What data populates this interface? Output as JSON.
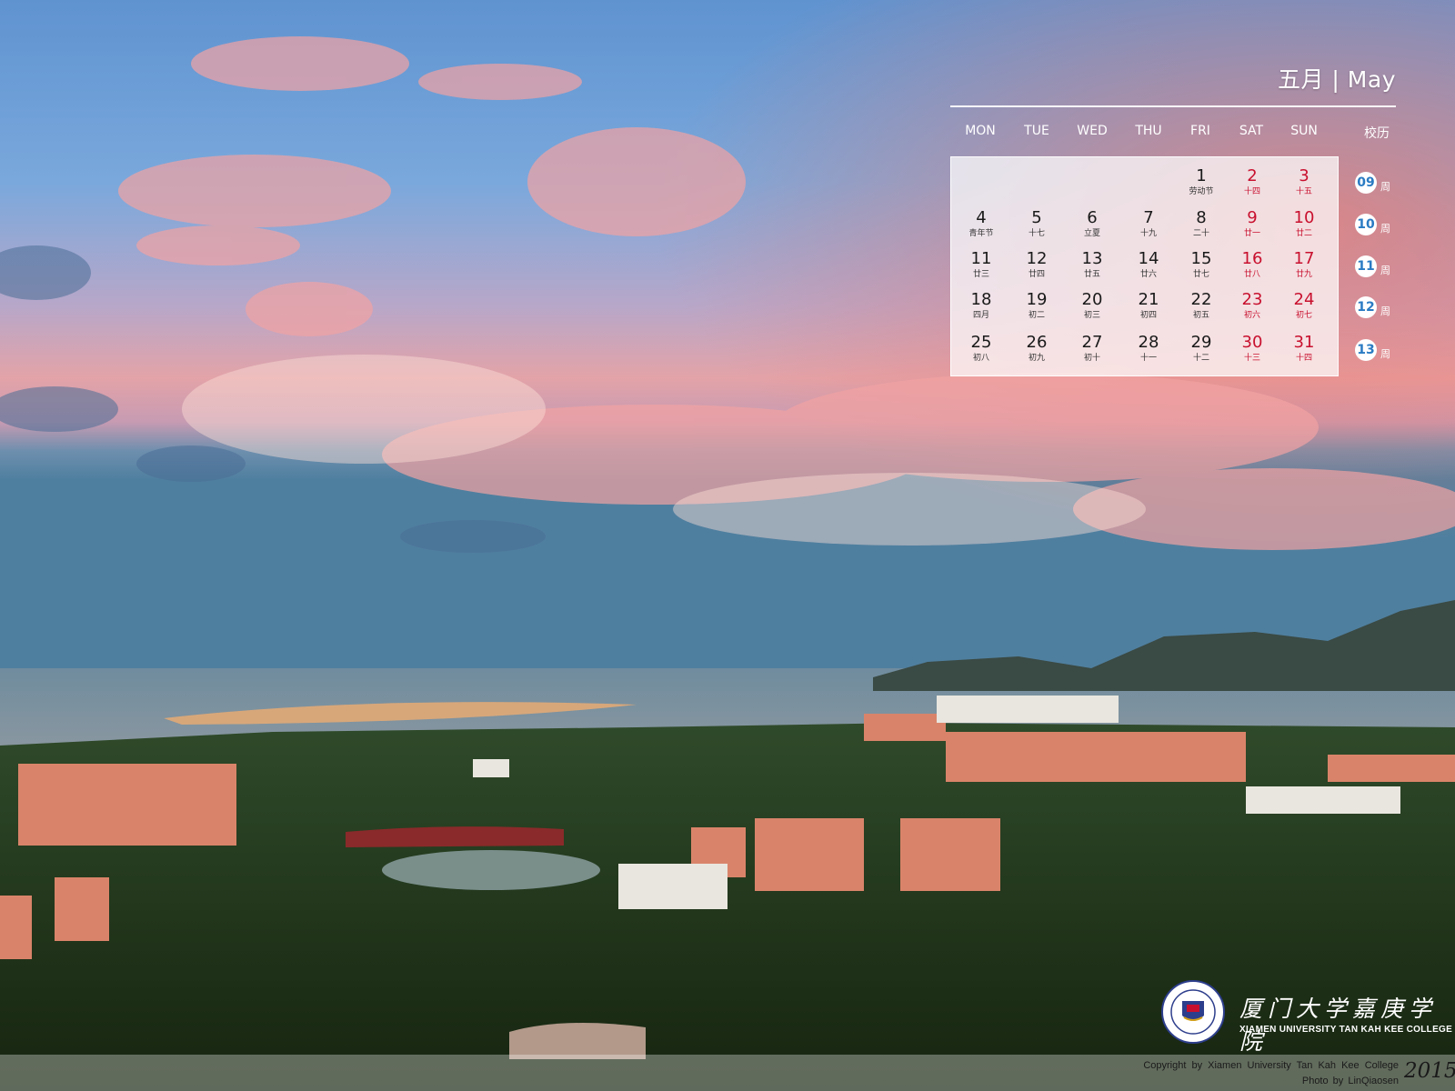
{
  "calendar": {
    "title": "五月 | May",
    "weekday_headers": [
      "MON",
      "TUE",
      "WED",
      "THU",
      "FRI",
      "SAT",
      "SUN"
    ],
    "school_calendar_header": "校历",
    "weeks": [
      {
        "week_no": "09",
        "week_unit": "周",
        "days": [
          null,
          null,
          null,
          null,
          {
            "n": "1",
            "sub": "劳动节",
            "weekend": false
          },
          {
            "n": "2",
            "sub": "十四",
            "weekend": true
          },
          {
            "n": "3",
            "sub": "十五",
            "weekend": true
          }
        ]
      },
      {
        "week_no": "10",
        "week_unit": "周",
        "days": [
          {
            "n": "4",
            "sub": "青年节",
            "weekend": false
          },
          {
            "n": "5",
            "sub": "十七",
            "weekend": false
          },
          {
            "n": "6",
            "sub": "立夏",
            "weekend": false
          },
          {
            "n": "7",
            "sub": "十九",
            "weekend": false
          },
          {
            "n": "8",
            "sub": "二十",
            "weekend": false
          },
          {
            "n": "9",
            "sub": "廿一",
            "weekend": true
          },
          {
            "n": "10",
            "sub": "廿二",
            "weekend": true
          }
        ]
      },
      {
        "week_no": "11",
        "week_unit": "周",
        "days": [
          {
            "n": "11",
            "sub": "廿三",
            "weekend": false
          },
          {
            "n": "12",
            "sub": "廿四",
            "weekend": false
          },
          {
            "n": "13",
            "sub": "廿五",
            "weekend": false
          },
          {
            "n": "14",
            "sub": "廿六",
            "weekend": false
          },
          {
            "n": "15",
            "sub": "廿七",
            "weekend": false
          },
          {
            "n": "16",
            "sub": "廿八",
            "weekend": true
          },
          {
            "n": "17",
            "sub": "廿九",
            "weekend": true
          }
        ]
      },
      {
        "week_no": "12",
        "week_unit": "周",
        "days": [
          {
            "n": "18",
            "sub": "四月",
            "weekend": false
          },
          {
            "n": "19",
            "sub": "初二",
            "weekend": false
          },
          {
            "n": "20",
            "sub": "初三",
            "weekend": false
          },
          {
            "n": "21",
            "sub": "初四",
            "weekend": false
          },
          {
            "n": "22",
            "sub": "初五",
            "weekend": false
          },
          {
            "n": "23",
            "sub": "初六",
            "weekend": true
          },
          {
            "n": "24",
            "sub": "初七",
            "weekend": true
          }
        ]
      },
      {
        "week_no": "13",
        "week_unit": "周",
        "days": [
          {
            "n": "25",
            "sub": "初八",
            "weekend": false
          },
          {
            "n": "26",
            "sub": "初九",
            "weekend": false
          },
          {
            "n": "27",
            "sub": "初十",
            "weekend": false
          },
          {
            "n": "28",
            "sub": "十一",
            "weekend": false
          },
          {
            "n": "29",
            "sub": "十二",
            "weekend": false
          },
          {
            "n": "30",
            "sub": "十三",
            "weekend": true
          },
          {
            "n": "31",
            "sub": "十四",
            "weekend": true
          }
        ]
      }
    ]
  },
  "branding": {
    "college_name_cn": "厦门大学嘉庚学院",
    "college_name_en": "XIAMEN UNIVERSITY TAN KAH KEE COLLEGE",
    "logo_icon": "college-seal-icon"
  },
  "footer": {
    "copyright": "Copyright by Xiamen University Tan Kah Kee College",
    "photo_credit": "Photo by LinQiaosen",
    "year": "2015"
  },
  "colors": {
    "weekend_red": "#c8102e",
    "week_number_blue": "#2a7bc3"
  }
}
